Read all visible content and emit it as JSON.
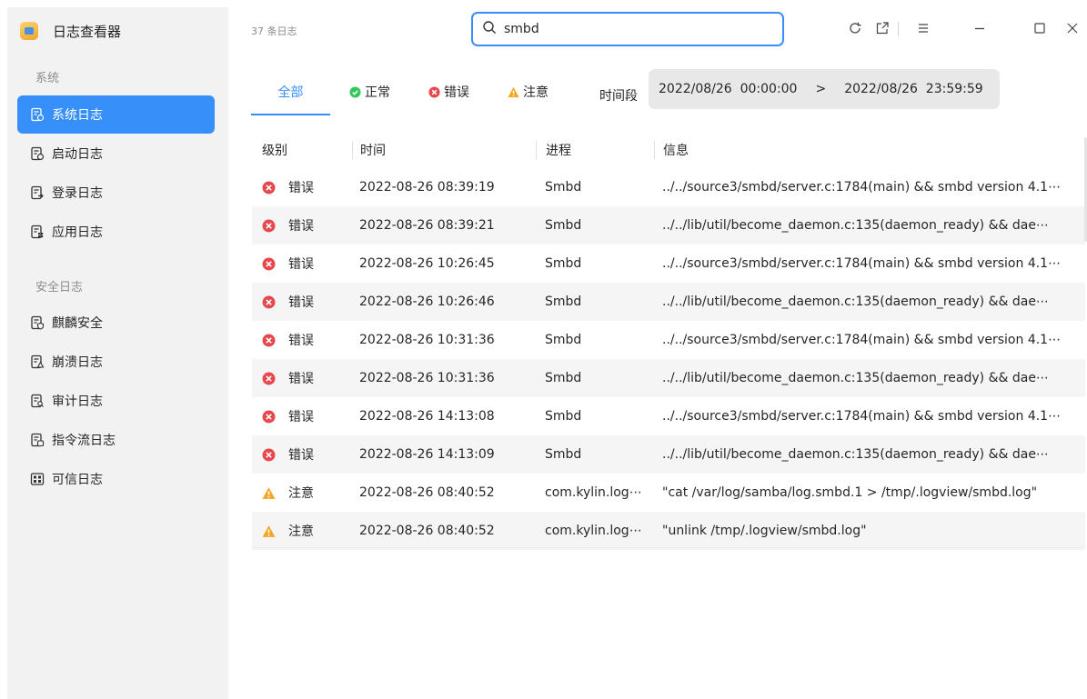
{
  "app": {
    "title": "日志查看器"
  },
  "sidebar": {
    "section_system": "系统",
    "section_security": "安全日志",
    "items": [
      {
        "label": "系统日志",
        "icon": "system-log-icon",
        "active": true
      },
      {
        "label": "启动日志",
        "icon": "boot-log-icon"
      },
      {
        "label": "登录日志",
        "icon": "login-log-icon"
      },
      {
        "label": "应用日志",
        "icon": "app-log-icon"
      },
      {
        "label": "麒麟安全",
        "icon": "kylin-security-icon"
      },
      {
        "label": "崩溃日志",
        "icon": "crash-log-icon"
      },
      {
        "label": "审计日志",
        "icon": "audit-log-icon"
      },
      {
        "label": "指令流日志",
        "icon": "command-log-icon"
      },
      {
        "label": "可信日志",
        "icon": "trusted-log-icon"
      }
    ]
  },
  "header": {
    "count_label": "37 条日志",
    "search": {
      "value": "smbd",
      "placeholder": ""
    }
  },
  "filters": {
    "tabs": [
      {
        "label": "全部",
        "active": true
      },
      {
        "label": "正常",
        "icon": "ok-icon"
      },
      {
        "label": "错误",
        "icon": "error-icon"
      },
      {
        "label": "注意",
        "icon": "warning-icon"
      }
    ],
    "period_label": "时间段",
    "date_start": "2022/08/26  00:00:00",
    "date_arrow": ">",
    "date_end": "2022/08/26  23:59:59"
  },
  "table": {
    "columns": [
      "级别",
      "时间",
      "进程",
      "信息"
    ],
    "rows": [
      {
        "level": "错误",
        "type": "error",
        "time": "2022-08-26 08:39:19",
        "process": "Smbd",
        "info": "../../source3/smbd/server.c:1784(main) && smbd version 4.1⋯"
      },
      {
        "level": "错误",
        "type": "error",
        "time": "2022-08-26 08:39:21",
        "process": "Smbd",
        "info": "../../lib/util/become_daemon.c:135(daemon_ready) && dae⋯"
      },
      {
        "level": "错误",
        "type": "error",
        "time": "2022-08-26 10:26:45",
        "process": "Smbd",
        "info": "../../source3/smbd/server.c:1784(main) && smbd version 4.1⋯"
      },
      {
        "level": "错误",
        "type": "error",
        "time": "2022-08-26 10:26:46",
        "process": "Smbd",
        "info": "../../lib/util/become_daemon.c:135(daemon_ready) && dae⋯"
      },
      {
        "level": "错误",
        "type": "error",
        "time": "2022-08-26 10:31:36",
        "process": "Smbd",
        "info": "../../source3/smbd/server.c:1784(main) && smbd version 4.1⋯"
      },
      {
        "level": "错误",
        "type": "error",
        "time": "2022-08-26 10:31:36",
        "process": "Smbd",
        "info": "../../lib/util/become_daemon.c:135(daemon_ready) && dae⋯"
      },
      {
        "level": "错误",
        "type": "error",
        "time": "2022-08-26 14:13:08",
        "process": "Smbd",
        "info": "../../source3/smbd/server.c:1784(main) && smbd version 4.1⋯"
      },
      {
        "level": "错误",
        "type": "error",
        "time": "2022-08-26 14:13:09",
        "process": "Smbd",
        "info": "../../lib/util/become_daemon.c:135(daemon_ready) && dae⋯"
      },
      {
        "level": "注意",
        "type": "warning",
        "time": "2022-08-26 08:40:52",
        "process": "com.kylin.log⋯",
        "info": "\"cat /var/log/samba/log.smbd.1 > /tmp/.logview/smbd.log\""
      },
      {
        "level": "注意",
        "type": "warning",
        "time": "2022-08-26 08:40:52",
        "process": "com.kylin.log⋯",
        "info": "\"unlink /tmp/.logview/smbd.log\""
      }
    ]
  },
  "colors": {
    "accent": "#3790fa",
    "error": "#e8474e",
    "warning": "#f5a623",
    "ok": "#34c759"
  }
}
